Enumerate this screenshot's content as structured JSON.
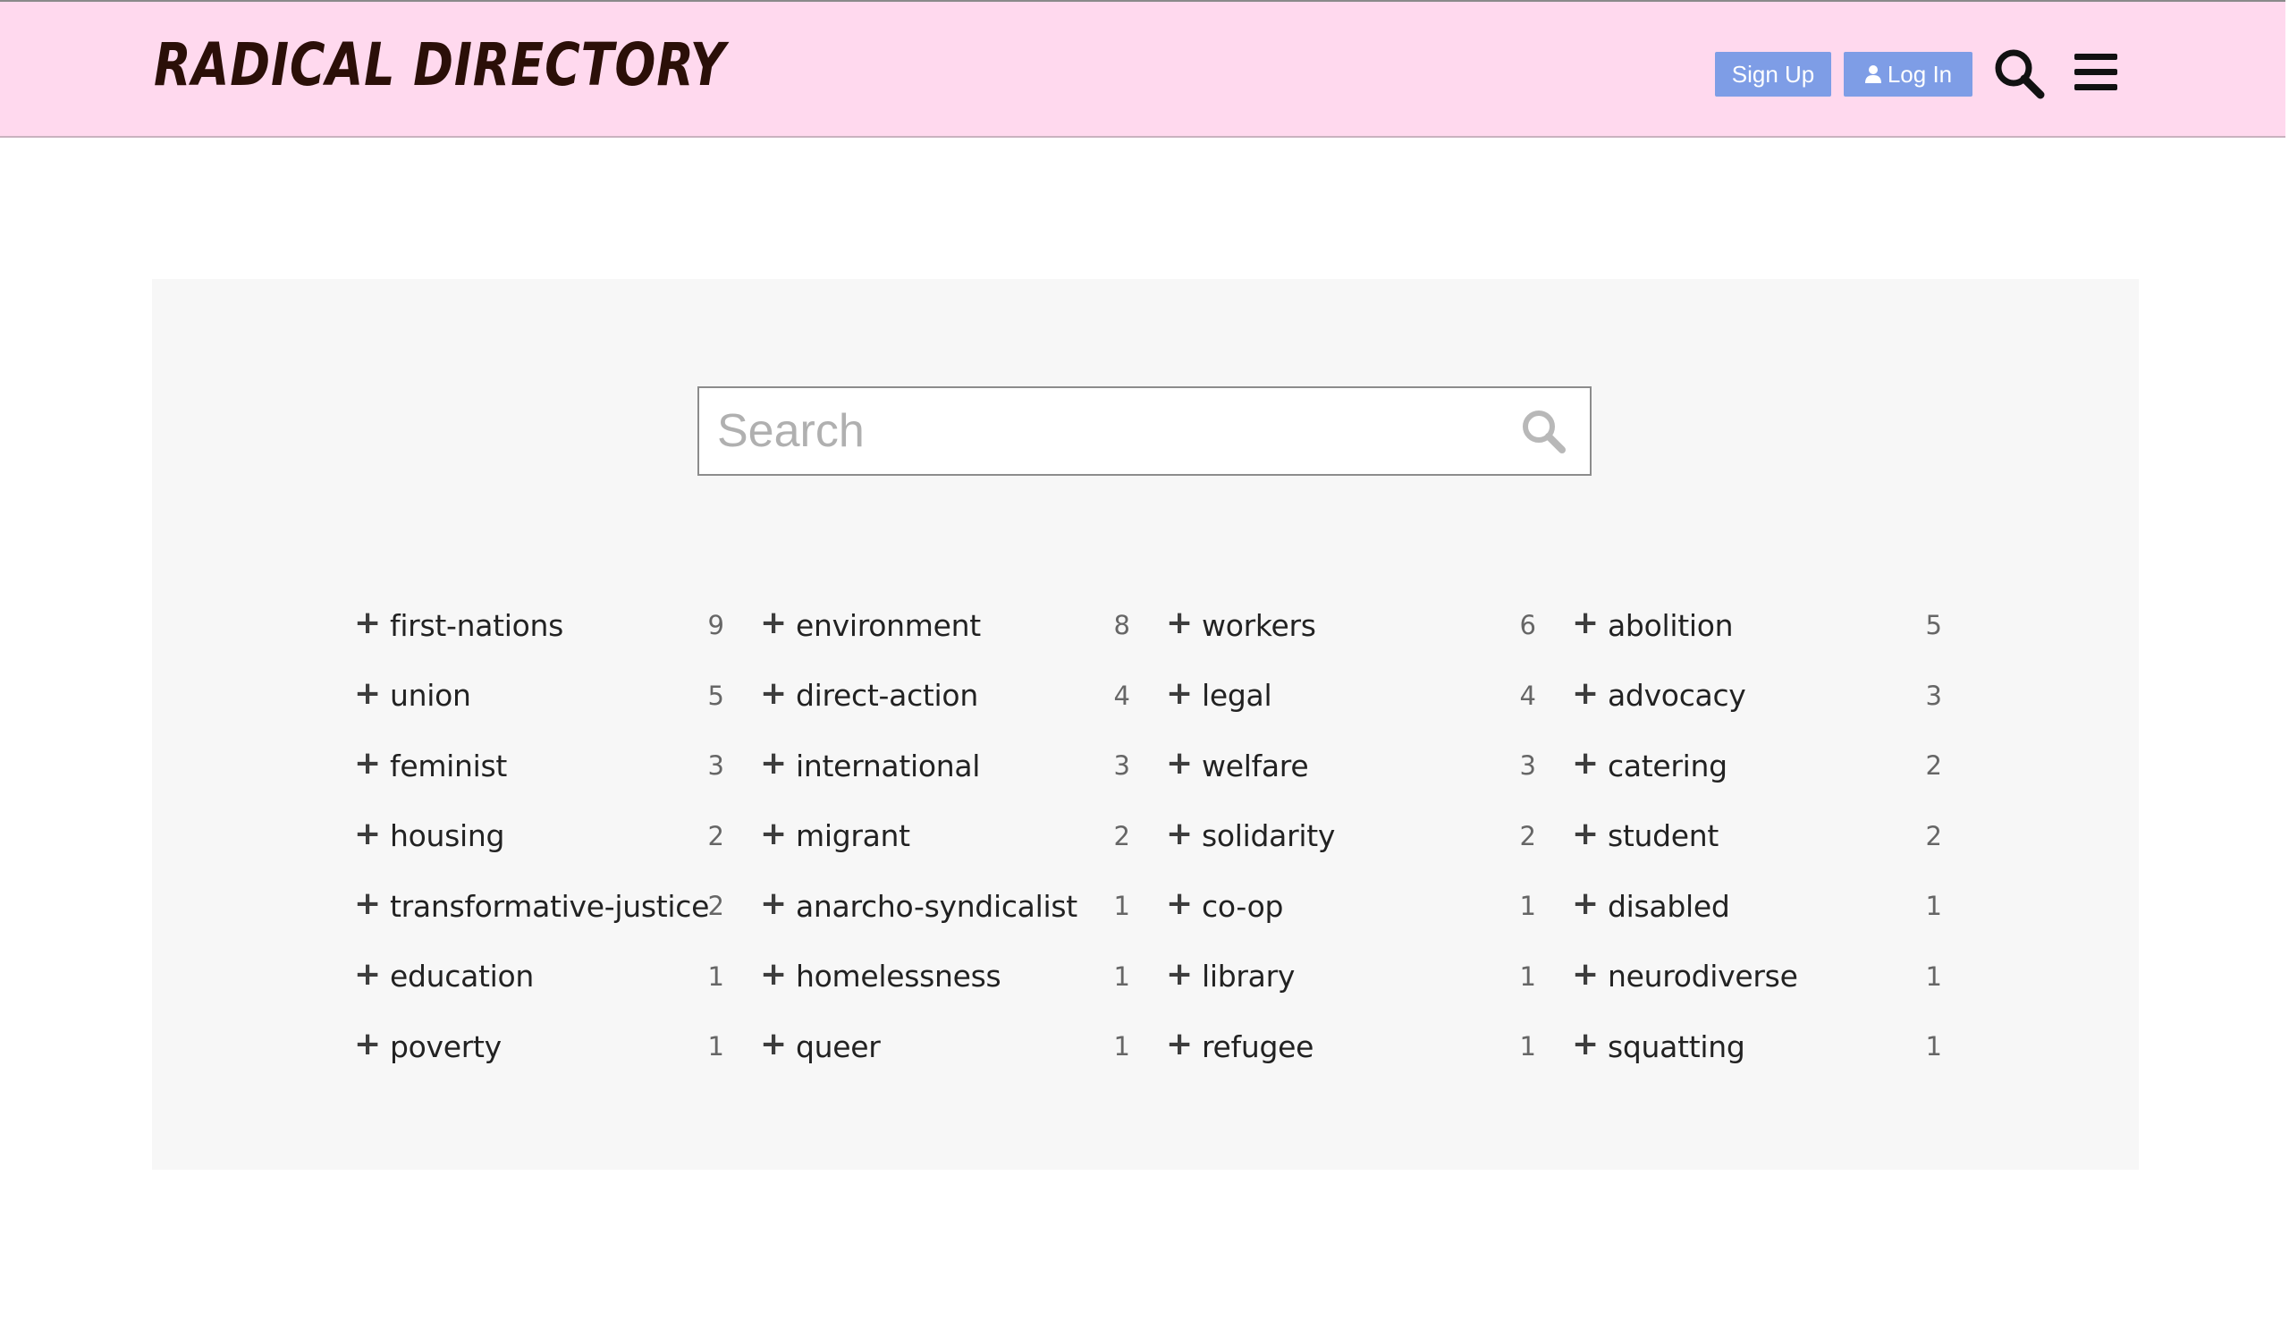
{
  "header": {
    "logo": "RADICAL DIRECTORY",
    "signup_label": "Sign Up",
    "login_label": "Log In",
    "search_icon": "search-icon",
    "menu_icon": "menu-icon",
    "bg_color": "#ffd9ee",
    "button_color": "#7e9de6"
  },
  "search": {
    "placeholder": "Search",
    "value": ""
  },
  "tags": [
    {
      "name": "first-nations",
      "count": "9"
    },
    {
      "name": "environment",
      "count": "8"
    },
    {
      "name": "workers",
      "count": "6"
    },
    {
      "name": "abolition",
      "count": "5"
    },
    {
      "name": "union",
      "count": "5"
    },
    {
      "name": "direct-action",
      "count": "4"
    },
    {
      "name": "legal",
      "count": "4"
    },
    {
      "name": "advocacy",
      "count": "3"
    },
    {
      "name": "feminist",
      "count": "3"
    },
    {
      "name": "international",
      "count": "3"
    },
    {
      "name": "welfare",
      "count": "3"
    },
    {
      "name": "catering",
      "count": "2"
    },
    {
      "name": "housing",
      "count": "2"
    },
    {
      "name": "migrant",
      "count": "2"
    },
    {
      "name": "solidarity",
      "count": "2"
    },
    {
      "name": "student",
      "count": "2"
    },
    {
      "name": "transformative-justice",
      "count": "2"
    },
    {
      "name": "anarcho-syndicalist",
      "count": "1"
    },
    {
      "name": "co-op",
      "count": "1"
    },
    {
      "name": "disabled",
      "count": "1"
    },
    {
      "name": "education",
      "count": "1"
    },
    {
      "name": "homelessness",
      "count": "1"
    },
    {
      "name": "library",
      "count": "1"
    },
    {
      "name": "neurodiverse",
      "count": "1"
    },
    {
      "name": "poverty",
      "count": "1"
    },
    {
      "name": "queer",
      "count": "1"
    },
    {
      "name": "refugee",
      "count": "1"
    },
    {
      "name": "squatting",
      "count": "1"
    }
  ]
}
